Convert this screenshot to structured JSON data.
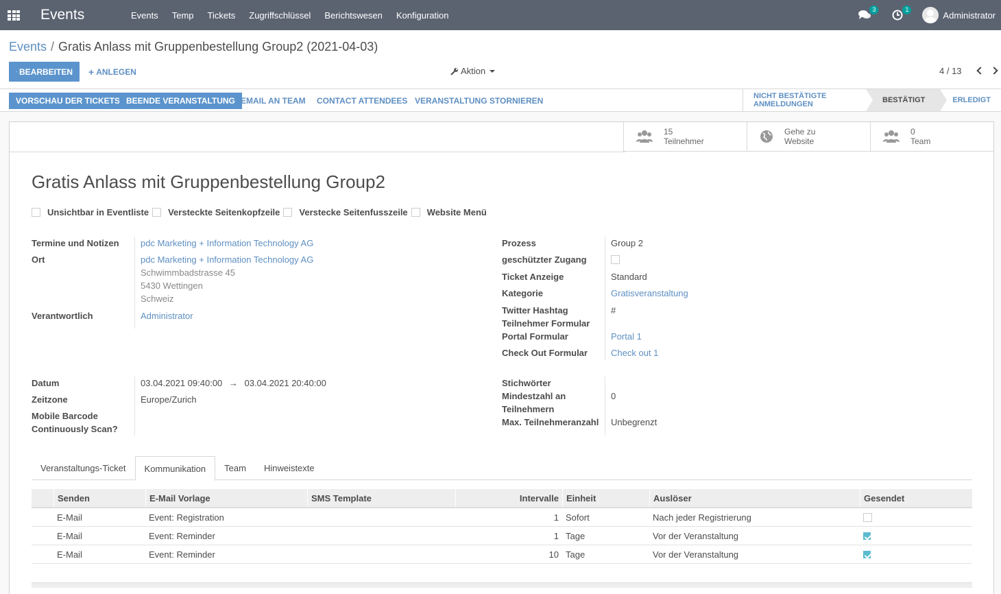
{
  "topbar": {
    "brand": "Events",
    "menu": [
      "Events",
      "Temp",
      "Tickets",
      "Zugriffschlüssel",
      "Berichtswesen",
      "Konfiguration"
    ],
    "chat_count": "3",
    "activity_count": "1",
    "user_name": "Administrator"
  },
  "breadcrumb": {
    "parent": "Events",
    "separator": "/",
    "current": "Gratis Anlass mit Gruppenbestellung Group2 (2021-04-03)"
  },
  "control": {
    "edit_label": "BEARBEITEN",
    "create_label": "ANLEGEN",
    "action_label": "Aktion",
    "pager": "4 / 13"
  },
  "statusbar": {
    "buttons": [
      "VORSCHAU DER TICKETS",
      "BEENDE VERANSTALTUNG",
      "EMAIL AN TEAM",
      "CONTACT ATTENDEES",
      "VERANSTALTUNG STORNIEREN"
    ],
    "stages": [
      "NICHT BESTÄTIGTE ANMELDUNGEN",
      "BESTÄTIGT",
      "ERLEDIGT"
    ],
    "active_stage": "BESTÄTIGT"
  },
  "stat_buttons": [
    {
      "value": "15",
      "label": "Teilnehmer",
      "icon": "users-icon"
    },
    {
      "value": "Gehe zu",
      "label": "Website",
      "icon": "globe-icon"
    },
    {
      "value": "0",
      "label": "Team",
      "icon": "users-icon"
    }
  ],
  "event": {
    "title": "Gratis Anlass mit Gruppenbestellung Group2",
    "checkboxes": [
      {
        "label": "Unsichtbar in Eventliste",
        "checked": false
      },
      {
        "label": "Versteckte Seitenkopfzeile",
        "checked": false
      },
      {
        "label": "Verstecke Seitenfusszeile",
        "checked": false
      },
      {
        "label": "Website Menü",
        "checked": false
      }
    ],
    "left": {
      "termine_label": "Termine und Notizen",
      "termine_value": "pdc Marketing + Information Technology AG",
      "ort_label": "Ort",
      "ort_name": "pdc Marketing + Information Technology AG",
      "ort_street": "Schwimmbadstrasse 45",
      "ort_city": "5430 Wettingen",
      "ort_country": "Schweiz",
      "verantwortlich_label": "Verantwortlich",
      "verantwortlich_value": "Administrator",
      "datum_label": "Datum",
      "datum_start": "03.04.2021 09:40:00",
      "datum_arrow": "→",
      "datum_end": "03.04.2021 20:40:00",
      "zeitzone_label": "Zeitzone",
      "zeitzone_value": "Europe/Zurich",
      "barcode_label_1": "Mobile Barcode",
      "barcode_label_2": "Continuously Scan?"
    },
    "right": {
      "prozess_label": "Prozess",
      "prozess_value": "Group 2",
      "zugang_label": "geschützter Zugang",
      "ticket_label": "Ticket Anzeige",
      "ticket_value": "Standard",
      "kategorie_label": "Kategorie",
      "kategorie_value": "Gratisveranstaltung",
      "hashtag_label": "Twitter Hashtag",
      "hashtag_value": "#",
      "teilnehmer_formular_label": "Teilnehmer Formular",
      "portal_label": "Portal Formular",
      "portal_value": "Portal 1",
      "checkout_label": "Check Out Formular",
      "checkout_value": "Check out 1",
      "stichwoerter_label": "Stichwörter",
      "mindest_label_1": "Mindestzahl an",
      "mindest_label_2": "Teilnehmern",
      "mindest_value": "0",
      "max_label": "Max. Teilnehmeranzahl",
      "max_value": "Unbegrenzt"
    }
  },
  "tabs": [
    "Veranstaltungs-Ticket",
    "Kommunikation",
    "Team",
    "Hinweistexte"
  ],
  "active_tab": "Kommunikation",
  "table": {
    "headers": [
      "Senden",
      "E-Mail Vorlage",
      "SMS Template",
      "Intervalle",
      "Einheit",
      "Auslöser",
      "Gesendet"
    ],
    "rows": [
      {
        "senden": "E-Mail",
        "vorlage": "Event: Registration",
        "sms": "",
        "intervall": "1",
        "einheit": "Sofort",
        "ausloeser": "Nach jeder Registrierung",
        "gesendet": false
      },
      {
        "senden": "E-Mail",
        "vorlage": "Event: Reminder",
        "sms": "",
        "intervall": "1",
        "einheit": "Tage",
        "ausloeser": "Vor der Veranstaltung",
        "gesendet": true
      },
      {
        "senden": "E-Mail",
        "vorlage": "Event: Reminder",
        "sms": "",
        "intervall": "10",
        "einheit": "Tage",
        "ausloeser": "Vor der Veranstaltung",
        "gesendet": true
      }
    ]
  },
  "colors": {
    "navbar": "#5b6371",
    "primary": "#5b94cd",
    "link": "#5e8fc2",
    "badge": "#00a09d",
    "checked": "#5bbccf"
  }
}
